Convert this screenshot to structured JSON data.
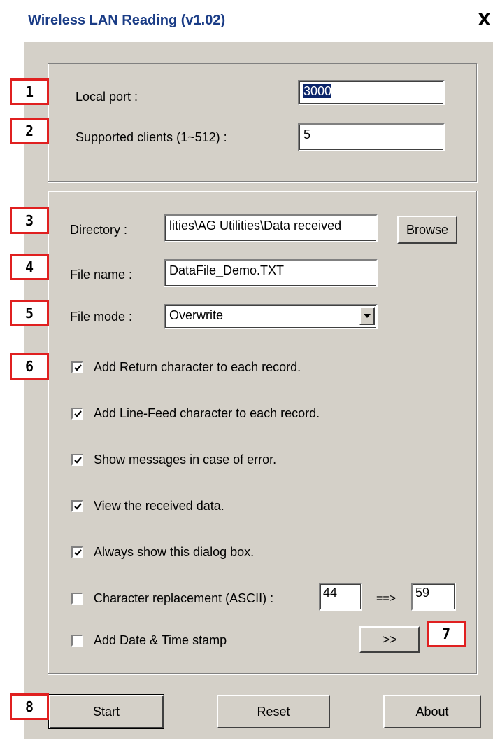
{
  "window": {
    "title": "Wireless LAN Reading (v1.02)",
    "close": "X"
  },
  "network": {
    "local_port_label": "Local port :",
    "local_port_value": "3000",
    "clients_label": "Supported clients (1~512) :",
    "clients_value": "5"
  },
  "file": {
    "directory_label": "Directory :",
    "directory_value": "lities\\AG Utilities\\Data received",
    "browse_label": "Browse",
    "filename_label": "File name :",
    "filename_value": "DataFile_Demo.TXT",
    "filemode_label": "File mode :",
    "filemode_value": "Overwrite"
  },
  "options": [
    {
      "label": "Add Return character to each record.",
      "checked": true
    },
    {
      "label": "Add Line-Feed character to each record.",
      "checked": true
    },
    {
      "label": "Show messages in case of error.",
      "checked": true
    },
    {
      "label": "View the received data.",
      "checked": true
    },
    {
      "label": "Always show this dialog box.",
      "checked": true
    },
    {
      "label": "Character replacement (ASCII) :",
      "checked": false
    },
    {
      "label": "Add Date & Time stamp",
      "checked": false
    }
  ],
  "replacement": {
    "from": "44",
    "arrow": "==>",
    "to": "59"
  },
  "more_label": ">>",
  "buttons": {
    "start": "Start",
    "reset": "Reset",
    "about": "About"
  },
  "markers": [
    "1",
    "2",
    "3",
    "4",
    "5",
    "6",
    "7",
    "8"
  ]
}
